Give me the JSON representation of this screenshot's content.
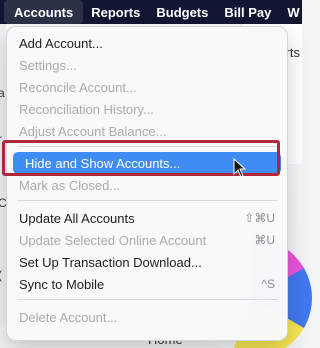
{
  "menubar": {
    "items": [
      "Accounts",
      "Reports",
      "Budgets",
      "Bill Pay",
      "W"
    ]
  },
  "background": {
    "right_text": "rts",
    "left_glyphs": [
      "a",
      "r",
      "(",
      "C"
    ],
    "home_label": "Home"
  },
  "dropdown": {
    "add_account": "Add Account...",
    "settings": "Settings...",
    "reconcile": "Reconcile Account...",
    "reconciliation_history": "Reconciliation History...",
    "adjust_balance": "Adjust Account Balance...",
    "hide_show": "Hide and Show Accounts...",
    "mark_closed": "Mark as Closed...",
    "update_all": "Update All Accounts",
    "update_all_shortcut": "⇧⌘U",
    "update_selected": "Update Selected Online Account",
    "update_selected_shortcut": "⌘U",
    "setup_download": "Set Up Transaction Download...",
    "sync_mobile": "Sync to Mobile",
    "sync_mobile_shortcut": "^S",
    "delete_account": "Delete Account..."
  },
  "colors": {
    "menubar_bg": "#121633",
    "highlight": "#3f8cf3",
    "annotation_border": "#b2263a"
  }
}
